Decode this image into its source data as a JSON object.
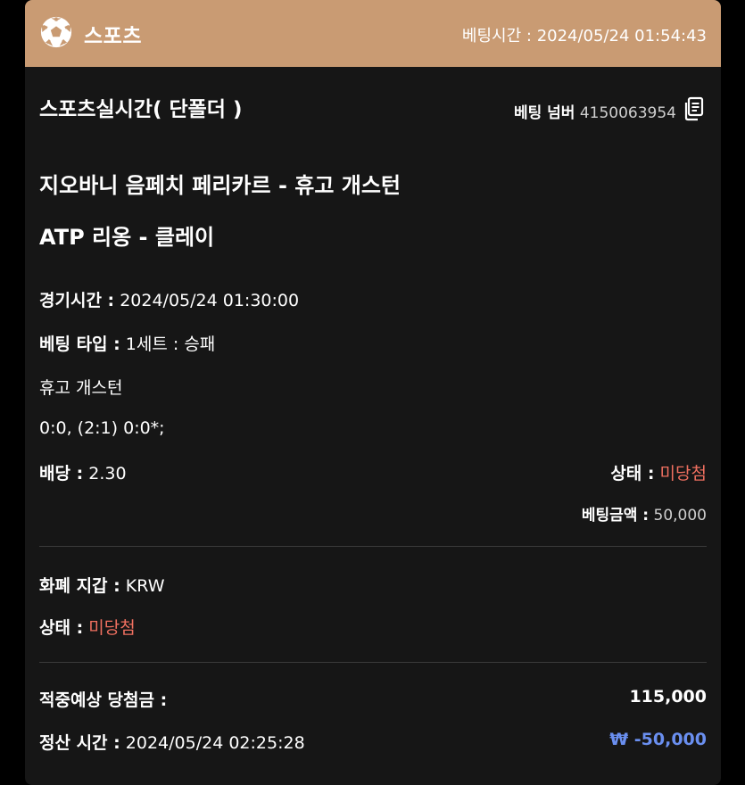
{
  "header": {
    "title": "스포츠",
    "bet_time_label": "베팅시간 :",
    "bet_time_value": "2024/05/24 01:54:43"
  },
  "bet": {
    "type_title": "스포츠실시간( 단폴더 )",
    "number_label": "베팅 넘버",
    "number_value": "4150063954",
    "match": "지오바니 음페치 페리카르 - 휴고 개스턴",
    "league": "ATP 리옹 - 클레이",
    "game_time_label": "경기시간 :",
    "game_time_value": "2024/05/24 01:30:00",
    "bet_type_label": "베팅 타입 :",
    "bet_type_value": "1세트 : 승패",
    "pick": "휴고 개스턴",
    "score": "0:0, (2:1) 0:0*;",
    "odds_label": "배당 :",
    "odds_value": "2.30",
    "status_label": "상태 :",
    "status_value": "미당첨",
    "amount_label": "베팅금액 :",
    "amount_value": "50,000"
  },
  "wallet": {
    "currency_label": "화폐 지갑 :",
    "currency_value": "KRW",
    "status_label": "상태 :",
    "status_value": "미당첨"
  },
  "settlement": {
    "expected_label": "적중예상 당첨금 :",
    "expected_value": "115,000",
    "time_label": "정산 시간 :",
    "time_value": "2024/05/24 02:25:28",
    "result_value": "₩ -50,000"
  },
  "icons": {
    "sport": "soccer-ball-icon",
    "copy": "copy-document-icon"
  },
  "colors": {
    "header_bg": "#C99B73",
    "card_bg": "#161616",
    "status_red": "#F07060",
    "loss_blue": "#6A8FF0"
  }
}
